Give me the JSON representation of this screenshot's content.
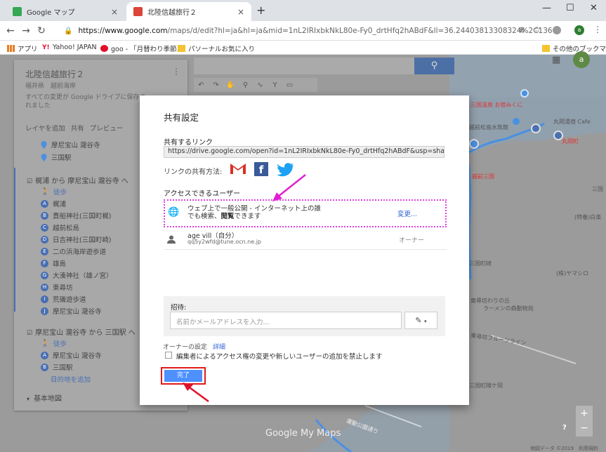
{
  "browser": {
    "tabs": [
      {
        "title": "Google マップ",
        "close": "×"
      },
      {
        "title": "北陸信越旅行２",
        "close": "×"
      }
    ],
    "new_tab": "+",
    "window_controls": [
      "—",
      "☐",
      "✕"
    ],
    "url_host": "https://www.google.com",
    "url_path": "/maps/d/edit?hl=ja&hl=ja&mid=1nL2IRIxbkNkL80e-Fy0_drtHfq2hABdF&ll=36.24403813308324%2C136.13071138...",
    "avatar_letter": "a",
    "bookmarks": [
      {
        "label": "アプリ"
      },
      {
        "label": "Yahoo! JAPAN"
      },
      {
        "label": "goo - 「月替わり季節..."
      },
      {
        "label": "パソーナルお気に入り"
      },
      {
        "label": "その他のブックマーク"
      }
    ]
  },
  "left_panel": {
    "title": "北陸信越旅行２",
    "subtitle": "福井県　越前海岸",
    "autosave": "すべての変更が Google ドライブに保存されました",
    "actions": [
      "レイヤを追加",
      "共有",
      "プレビュー"
    ],
    "layer1_items": [
      "摩尼宝山 瀧谷寺",
      "三国駅"
    ],
    "route1_title": "梶浦 から 摩尼宝山 瀧谷寺 へ",
    "route1_mode": "徒歩",
    "route1_stops": [
      {
        "letter": "A",
        "name": "梶浦"
      },
      {
        "letter": "B",
        "name": "貴船神社(三国町梶)"
      },
      {
        "letter": "C",
        "name": "越前松島"
      },
      {
        "letter": "D",
        "name": "日吉神社(三国町崎)"
      },
      {
        "letter": "E",
        "name": "二の浜海岸遊歩道"
      },
      {
        "letter": "F",
        "name": "雄島"
      },
      {
        "letter": "G",
        "name": "大湊神社（雄ノ宮）"
      },
      {
        "letter": "H",
        "name": "東尋坊"
      },
      {
        "letter": "I",
        "name": "荒磯遊歩道"
      },
      {
        "letter": "J",
        "name": "摩尼宝山 瀧谷寺"
      }
    ],
    "route2_title": "摩尼宝山 瀧谷寺 から 三国駅 へ",
    "route2_mode": "徒歩",
    "route2_stops": [
      {
        "letter": "A",
        "name": "摩尼宝山 瀧谷寺"
      },
      {
        "letter": "B",
        "name": "三国駅"
      }
    ],
    "add_destination": "目的地を追加",
    "base_map": "基本地図"
  },
  "map": {
    "labels": [
      {
        "text": "三国温泉 お宿みくに"
      },
      {
        "text": "丸岡湯宿 Cafe"
      },
      {
        "text": "越前松島水族館"
      },
      {
        "text": "丸岡町"
      },
      {
        "text": "越前三国"
      },
      {
        "text": "三国町崎"
      },
      {
        "text": "(株)ヤマシロ"
      },
      {
        "text": "(特養)白楽"
      },
      {
        "text": "東尋坊わりの丘"
      },
      {
        "text": "ラーメンの森動物苑"
      },
      {
        "text": "東尋坊フルーツライン"
      },
      {
        "text": "三国町陣ケ岡"
      },
      {
        "text": "運動公園通り"
      },
      {
        "text": "三国"
      }
    ],
    "google_logo": "Google My Maps",
    "footer": "地図データ ©2019　利用規約",
    "zoom_in": "+",
    "zoom_out": "−",
    "help": "?"
  },
  "dialog": {
    "title": "共有設定",
    "link_label": "共有するリンク",
    "link_url": "https://drive.google.com/open?id=1nL2IRIxbkNkL80e-Fy0_drtHfq2hABdF&usp=sharing",
    "share_via": "リンクの共有方法:",
    "access_label": "アクセスできるユーザー",
    "access_line1": "ウェブ上で一般公開 - インターネット上の誰",
    "access_line2_a": "でも検索、",
    "access_line2_b": "閲覧",
    "access_line2_c": "できます",
    "change": "変更...",
    "user_name": "age vill（自分）",
    "user_email": "qq5y2wfd@tune.ocn.ne.jp",
    "user_role": "オーナー",
    "invite_label": "招待:",
    "invite_placeholder": "名前かメールアドレスを入力...",
    "owner_settings": "オーナーの設定",
    "details": "詳細",
    "restrict_label": "編集者によるアクセス権の変更や新しいユーザーの追加を禁止します",
    "done": "完了"
  },
  "colors": {
    "accent": "#4d90fe",
    "highlight_dotted": "#e040e0",
    "highlight_red": "#e01a1a",
    "arrow_magenta": "#e020d0",
    "arrow_red": "#e0102a",
    "route_blue": "#4a90e2"
  }
}
